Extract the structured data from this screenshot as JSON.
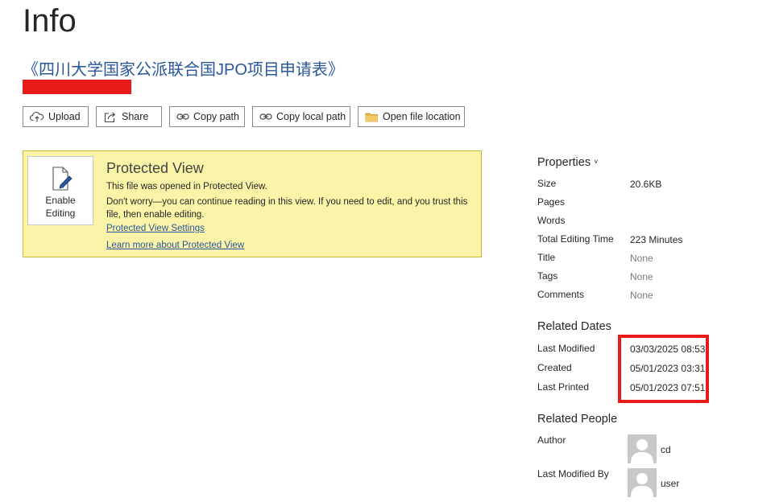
{
  "page": {
    "title": "Info",
    "document_title": "《四川大学国家公派联合国JPO项目申请表》"
  },
  "toolbar": {
    "upload": "Upload",
    "share": "Share",
    "copy_path": "Copy path",
    "copy_local_path": "Copy local path",
    "open_file_location": "Open file location"
  },
  "protected_view": {
    "enable_line1": "Enable",
    "enable_line2": "Editing",
    "title": "Protected View",
    "line1": "This file was opened in Protected View.",
    "line2": "Don't worry—you can continue reading in this view. If you need to edit, and you trust this file, then enable editing.",
    "settings_link": "Protected View Settings",
    "learn_link": "Learn more about Protected View"
  },
  "properties": {
    "header": "Properties",
    "items": [
      {
        "key": "Size",
        "value": "20.6KB"
      },
      {
        "key": "Pages",
        "value": ""
      },
      {
        "key": "Words",
        "value": ""
      },
      {
        "key": "Total Editing Time",
        "value": "223 Minutes"
      },
      {
        "key": "Title",
        "value": "None"
      },
      {
        "key": "Tags",
        "value": "None"
      },
      {
        "key": "Comments",
        "value": "None"
      }
    ]
  },
  "related_dates": {
    "header": "Related Dates",
    "items": [
      {
        "key": "Last Modified",
        "value": "03/03/2025 08:53"
      },
      {
        "key": "Created",
        "value": "05/01/2023 03:31"
      },
      {
        "key": "Last Printed",
        "value": "05/01/2023 07:51"
      }
    ]
  },
  "related_people": {
    "header": "Related People",
    "author_label": "Author",
    "author_name": "cd",
    "last_modified_by_label": "Last Modified By",
    "last_modified_by_name": "user"
  },
  "colors": {
    "accent": "#2b579a",
    "protected_bg": "#fbf4a8",
    "protected_border": "#c9b63c",
    "redaction": "#e81b1b"
  }
}
